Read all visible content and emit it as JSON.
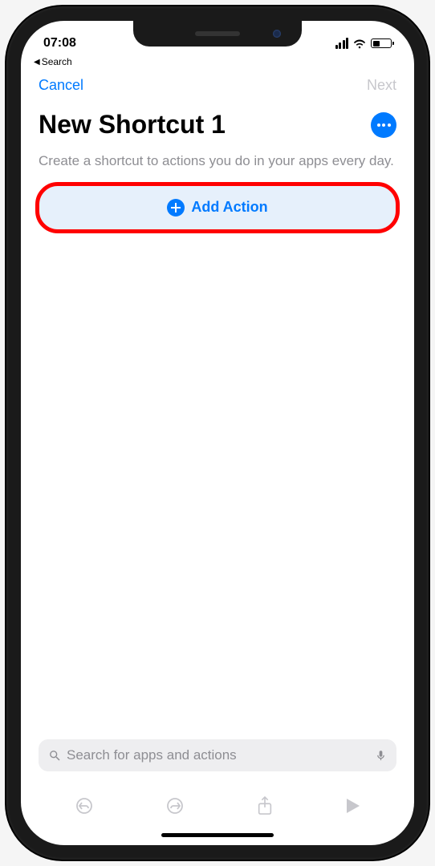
{
  "status_bar": {
    "time": "07:08",
    "breadcrumb_back": "Search"
  },
  "nav": {
    "cancel": "Cancel",
    "next": "Next"
  },
  "page": {
    "title": "New Shortcut 1",
    "subtitle": "Create a shortcut to actions you do in your apps every day."
  },
  "add_action": {
    "label": "Add Action"
  },
  "search": {
    "placeholder": "Search for apps and actions"
  }
}
